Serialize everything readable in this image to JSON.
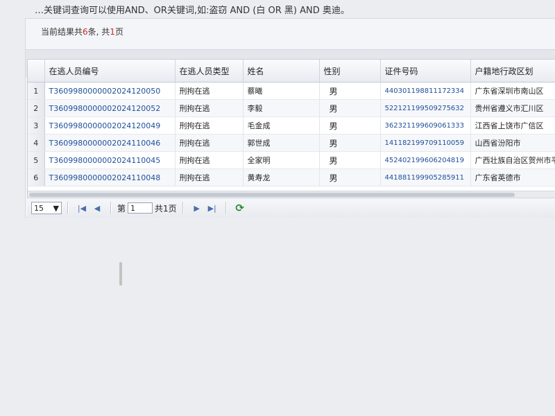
{
  "hint": "…关键词查询可以使用AND、OR关键词,如:盗窃 AND (白 OR 黑) AND 奥迪。",
  "summary": {
    "prefix": "当前结果共",
    "count": "6",
    "middle": "条, 共",
    "pages": "1",
    "suffix": "页"
  },
  "columns": [
    "在逃人员编号",
    "在逃人员类型",
    "姓名",
    "性别",
    "证件号码",
    "户籍地行政区划"
  ],
  "rows": [
    {
      "n": "1",
      "id": "T3609980000002024120050",
      "type": "刑拘在逃",
      "name": "蔡曦",
      "gender": "男",
      "cert": "440301198811172334",
      "region": "广东省深圳市南山区"
    },
    {
      "n": "2",
      "id": "T3609980000002024120052",
      "type": "刑拘在逃",
      "name": "李毅",
      "gender": "男",
      "cert": "522121199509275632",
      "region": "贵州省遵义市汇川区"
    },
    {
      "n": "3",
      "id": "T3609980000002024120049",
      "type": "刑拘在逃",
      "name": "毛金成",
      "gender": "男",
      "cert": "362321199609061333",
      "region": "江西省上饶市广信区"
    },
    {
      "n": "4",
      "id": "T3609980000002024110046",
      "type": "刑拘在逃",
      "name": "郭世成",
      "gender": "男",
      "cert": "141182199709110059",
      "region": "山西省汾阳市"
    },
    {
      "n": "5",
      "id": "T3609980000002024110045",
      "type": "刑拘在逃",
      "name": "全家明",
      "gender": "男",
      "cert": "452402199606204819",
      "region": "广西壮族自治区贺州市平"
    },
    {
      "n": "6",
      "id": "T3609980000002024110048",
      "type": "刑拘在逃",
      "name": "黄寿龙",
      "gender": "男",
      "cert": "441881199905285911",
      "region": "广东省英德市"
    }
  ],
  "pager": {
    "page_size": "15",
    "page_prefix": "第",
    "page_value": "1",
    "page_total": "共1页"
  }
}
